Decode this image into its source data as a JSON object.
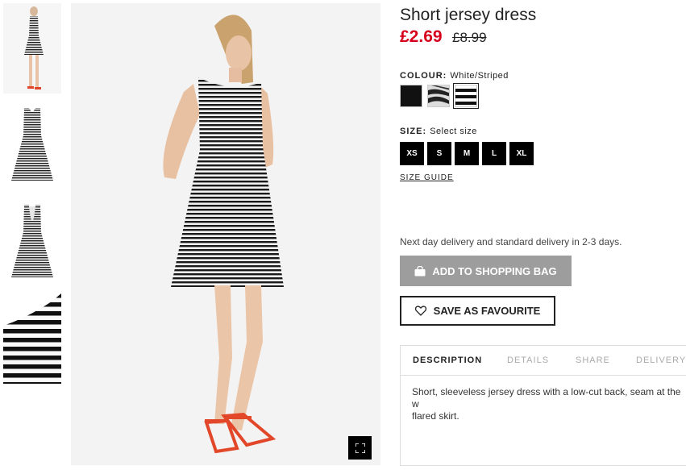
{
  "product": {
    "title": "Short jersey dress",
    "price_now": "£2.69",
    "price_old": "£8.99"
  },
  "colour": {
    "label": "COLOUR:",
    "selected": "White/Striped",
    "swatches": [
      {
        "name": "Black",
        "color": "#111111"
      },
      {
        "name": "Zebra",
        "color": "#444444"
      },
      {
        "name": "White/Striped",
        "color": "#ffffff",
        "selected": true
      }
    ]
  },
  "size": {
    "label": "SIZE:",
    "prompt": "Select size",
    "options": [
      "XS",
      "S",
      "M",
      "L",
      "XL"
    ],
    "guide": "SIZE GUIDE"
  },
  "delivery_text": "Next day delivery and standard delivery in 2-3 days.",
  "actions": {
    "add_to_bag": "ADD TO SHOPPING BAG",
    "save_favourite": "SAVE AS FAVOURITE"
  },
  "tabs": [
    "DESCRIPTION",
    "DETAILS",
    "SHARE",
    "DELIVERY"
  ],
  "active_tab": "DESCRIPTION",
  "description": "Short, sleeveless jersey dress with a low-cut back, seam at the w\nflared skirt.",
  "icons": {
    "bag": "shopping-bag-icon",
    "heart": "heart-icon",
    "expand": "expand-icon"
  },
  "colors": {
    "price": "#d6001c",
    "button_grey": "#9d9d9d",
    "dark": "#222222"
  }
}
